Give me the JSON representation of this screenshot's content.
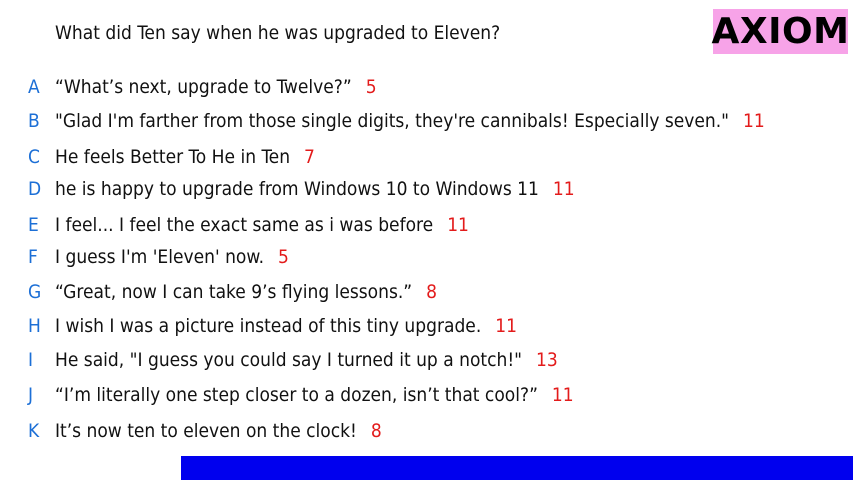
{
  "question": "What did Ten say when he was upgraded to Eleven?",
  "logo": "AXIOM",
  "colors": {
    "letter": "#1c6fd6",
    "score": "#e31b1b",
    "logo_bg": "#f7a3e8",
    "bottom_bar": "#0000ee"
  },
  "answers": [
    {
      "letter": "A",
      "text": "“What’s next, upgrade to Twelve?”",
      "score": "5"
    },
    {
      "letter": "B",
      "text": "\"Glad I'm farther from those single digits, they're cannibals! Especially seven.\"",
      "score": "11"
    },
    {
      "letter": "C",
      "text": "He feels Better To He in Ten",
      "score": "7"
    },
    {
      "letter": "D",
      "text": "he is happy to upgrade from Windows 10 to Windows 11",
      "score": "11"
    },
    {
      "letter": "E",
      "text": "I feel... I feel the exact same as i was before",
      "score": "11"
    },
    {
      "letter": "F",
      "text": "I guess I'm 'Eleven' now.",
      "score": "5"
    },
    {
      "letter": "G",
      "text": "“Great, now I can take 9’s flying lessons.”",
      "score": "8"
    },
    {
      "letter": "H",
      "text": "I wish I was a picture instead of this tiny upgrade.",
      "score": "11"
    },
    {
      "letter": "I",
      "text": "He said, \"I guess you could say I turned it up a notch!\"",
      "score": "13"
    },
    {
      "letter": "J",
      "text": "“I’m literally one step closer to a dozen, isn’t that cool?”",
      "score": "11"
    },
    {
      "letter": "K",
      "text": "It’s now ten to eleven on the clock!",
      "score": "8"
    }
  ]
}
